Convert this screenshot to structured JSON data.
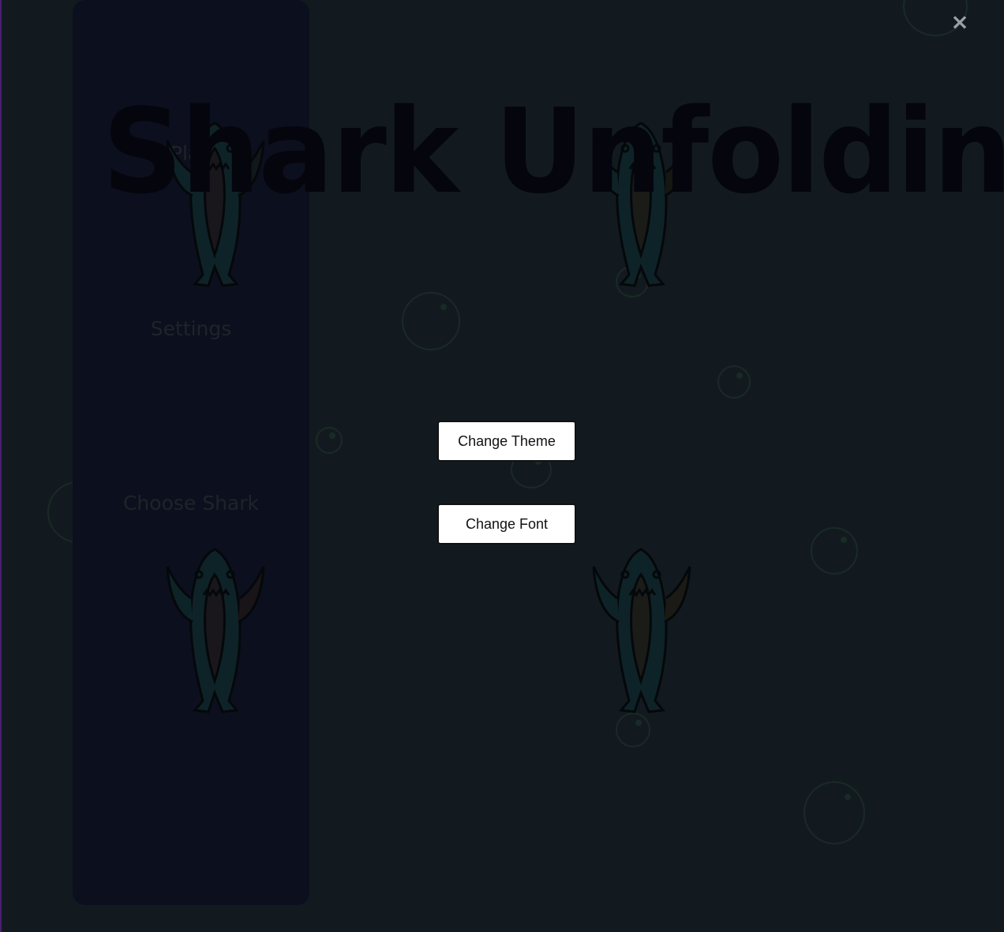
{
  "app": {
    "title": "Shark Unfolding"
  },
  "sidebar": {
    "items": [
      {
        "label": "Play"
      },
      {
        "label": "Settings"
      },
      {
        "label": "Choose Shark"
      }
    ]
  },
  "modal": {
    "close_label": "×",
    "buttons": [
      {
        "label": "Change Theme"
      },
      {
        "label": "Change Font"
      }
    ]
  },
  "colors": {
    "background": "#121a1f",
    "sidebar": "#0c0f1e",
    "button_bg": "#ffffff",
    "title_text": "#05050d"
  },
  "icons": {
    "close": "close-icon",
    "shark": "shark-illustration",
    "bubble": "bubble-decoration"
  }
}
